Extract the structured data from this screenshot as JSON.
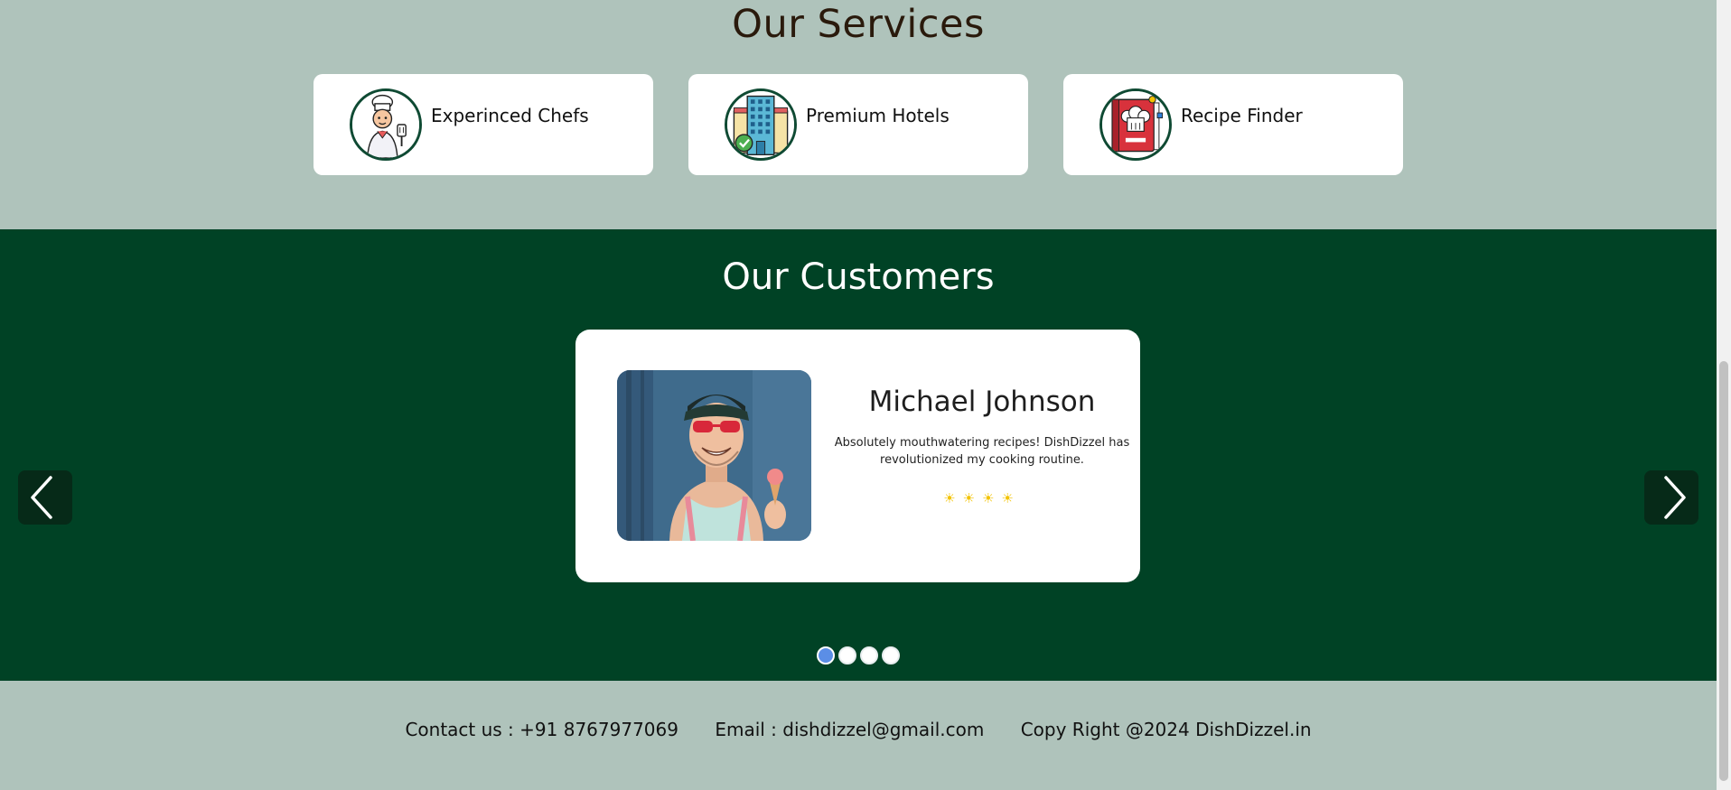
{
  "services": {
    "title": "Our Services",
    "items": [
      {
        "label": "Experinced Chefs",
        "icon": "chef-icon"
      },
      {
        "label": "Premium Hotels",
        "icon": "hotel-icon"
      },
      {
        "label": "Recipe Finder",
        "icon": "recipe-book-icon"
      }
    ]
  },
  "customers": {
    "title": "Our Customers",
    "testimonial": {
      "name": "Michael Johnson",
      "quote": "Absolutely mouthwatering recipes! DishDizzel has revolutionized my cooking routine.",
      "rating": 4,
      "rating_stars": "☀☀☀☀"
    },
    "slide_count": 4,
    "active_slide": 1
  },
  "footer": {
    "contact": "Contact us : +91 8767977069",
    "email": "Email : dishdizzel@gmail.com",
    "copyright": "Copy Right @2024 DishDizzel.in"
  },
  "colors": {
    "page_bg": "#afc3bb",
    "customers_bg": "#004225",
    "nav_button_bg": "#062a18",
    "active_dot": "#5b8ee6",
    "star": "#f3c300"
  }
}
